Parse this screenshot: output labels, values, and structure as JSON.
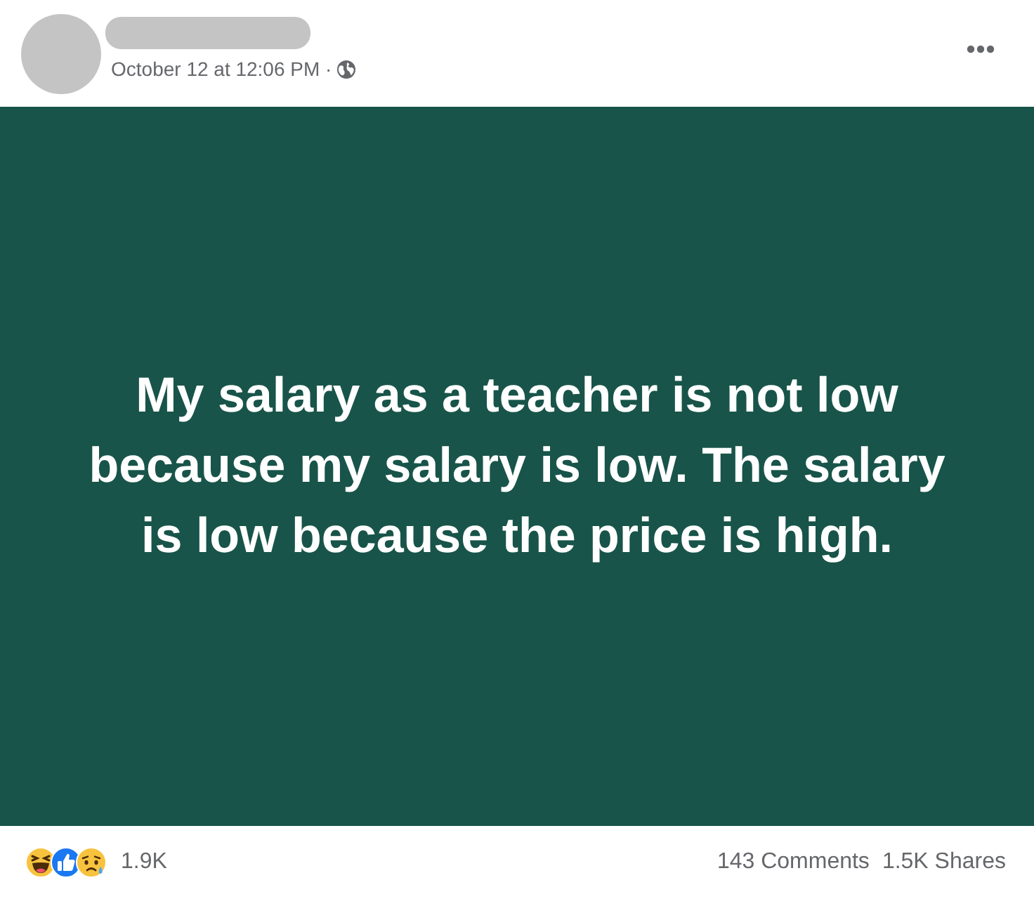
{
  "header": {
    "timestamp": "October 12 at 12:06 PM ·"
  },
  "post": {
    "text": "My salary as a teacher is not low because my salary is low. The salary is low because the price is high."
  },
  "footer": {
    "reaction_count": "1.9K",
    "comments": "143 Comments",
    "shares": "1.5K Shares"
  }
}
